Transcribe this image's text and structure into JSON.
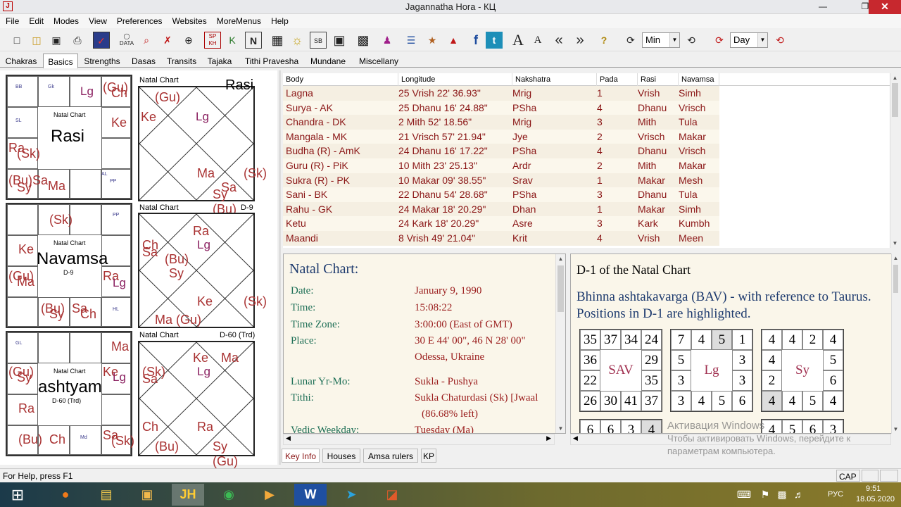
{
  "window": {
    "title": "Jagannatha Hora - КЦ"
  },
  "menu": [
    "File",
    "Edit",
    "Modes",
    "View",
    "Preferences",
    "Websites",
    "MoreMenus",
    "Help"
  ],
  "toolbar": {
    "min_select": "Min",
    "day_select": "Day",
    "sp_kh": "SP\nKH",
    "data": "DATA"
  },
  "tabs": [
    "Chakras",
    "Basics",
    "Strengths",
    "Dasas",
    "Transits",
    "Tajaka",
    "Tithi Pravesha",
    "Mundane",
    "Miscellany"
  ],
  "charts": {
    "rasi": {
      "label": "Natal Chart",
      "name": "Rasi",
      "sub": ""
    },
    "navamsa": {
      "label": "Natal Chart",
      "name": "Navamsa",
      "sub": "D-9"
    },
    "d60": {
      "label": "Natal Chart",
      "name": "ashtyam",
      "sub": "D-60 (Trd)"
    },
    "nc1": {
      "label": "Natal Chart",
      "tag": "Rasi"
    },
    "nc2": {
      "label": "Natal Chart",
      "tag": "D-9"
    },
    "nc3": {
      "label": "Natal Chart",
      "tag": "D-60 (Trd)"
    }
  },
  "table": {
    "headers": [
      "Body",
      "Longitude",
      "Nakshatra",
      "Pada",
      "Rasi",
      "Navamsa"
    ],
    "rows": [
      [
        "Lagna",
        "25 Vrish 22' 36.93\"",
        "Mrig",
        "1",
        "Vrish",
        "Simh"
      ],
      [
        "Surya - AK",
        "25 Dhanu 16' 24.88\"",
        "PSha",
        "4",
        "Dhanu",
        "Vrisch"
      ],
      [
        "Chandra - DK",
        "2 Mith 52' 18.56\"",
        "Mrig",
        "3",
        "Mith",
        "Tula"
      ],
      [
        "Mangala - MK",
        "21 Vrisch 57' 21.94\"",
        "Jye",
        "2",
        "Vrisch",
        "Makar"
      ],
      [
        "Budha (R) - AmK",
        "24 Dhanu 16' 17.22\"",
        "PSha",
        "4",
        "Dhanu",
        "Vrisch"
      ],
      [
        "Guru (R) - PiK",
        "10 Mith 23' 25.13\"",
        "Ardr",
        "2",
        "Mith",
        "Makar"
      ],
      [
        "Sukra (R) - PK",
        "10 Makar 09' 38.55\"",
        "Srav",
        "1",
        "Makar",
        "Mesh"
      ],
      [
        "Sani - BK",
        "22 Dhanu 54' 28.68\"",
        "PSha",
        "3",
        "Dhanu",
        "Tula"
      ],
      [
        "Rahu - GK",
        "24 Makar 18' 20.29\"",
        "Dhan",
        "1",
        "Makar",
        "Simh"
      ],
      [
        "Ketu",
        "24 Kark 18' 20.29\"",
        "Asre",
        "3",
        "Kark",
        "Kumbh"
      ],
      [
        "Maandi",
        "8 Vrish 49' 21.04\"",
        "Krit",
        "4",
        "Vrish",
        "Meen"
      ]
    ]
  },
  "keyinfo": {
    "title": "Natal Chart:",
    "fields": [
      {
        "label": "Date:",
        "value": "January 9, 1990"
      },
      {
        "label": "Time:",
        "value": "15:08:22"
      },
      {
        "label": "Time Zone:",
        "value": "3:00:00 (East of GMT)"
      },
      {
        "label": "Place:",
        "value": "30 E 44' 00\", 46 N 28' 00\""
      },
      {
        "label": "",
        "value": "Odessa, Ukraine"
      },
      {
        "label": "Lunar Yr-Mo:",
        "value": "Sukla - Pushya"
      },
      {
        "label": "Tithi:",
        "value": "Sukla Chaturdasi (Sk) [Jwaal"
      },
      {
        "label": "",
        "value": "(86.68% left)"
      },
      {
        "label": "Vedic Weekday:",
        "value": "Tuesday (Ma)"
      }
    ]
  },
  "bav": {
    "title": "D-1 of the Natal Chart",
    "desc1": "Bhinna ashtakavarga (BAV) - with reference to Taurus.",
    "desc2": "Positions in D-1 are highlighted.",
    "sav": {
      "center": "SAV",
      "top": [
        "35",
        "37",
        "34",
        "24"
      ],
      "right": [
        "29",
        "35"
      ],
      "left": [
        "36",
        "22"
      ],
      "bottom": [
        "26",
        "30",
        "41",
        "37"
      ]
    },
    "lg": {
      "center": "Lg",
      "top": [
        "7",
        "4",
        "5",
        "1"
      ],
      "right": [
        "3",
        "3"
      ],
      "left": [
        "5",
        "3"
      ],
      "bottom": [
        "3",
        "4",
        "5",
        "6"
      ]
    },
    "sy": {
      "center": "Sy",
      "top": [
        "4",
        "4",
        "2",
        "4"
      ],
      "right": [
        "5",
        "6"
      ],
      "left": [
        "4",
        "2"
      ],
      "bottom": [
        "4",
        "4",
        "5",
        "4"
      ]
    },
    "row2a": [
      "6",
      "6",
      "3",
      "4"
    ],
    "row2c": [
      "4",
      "5",
      "6",
      "3"
    ]
  },
  "bottom_tabs": [
    "Key Info",
    "Houses",
    "Amsa rulers",
    "KP"
  ],
  "status": {
    "help": "For Help, press F1",
    "cap": "CAP"
  },
  "watermark": {
    "line1": "Активация Windows",
    "line2": "Чтобы активировать Windows, перейдите к",
    "line3": "параметрам компьютера."
  },
  "taskbar": {
    "lang": "РУС",
    "time": "9:51",
    "date": "18.05.2020"
  }
}
